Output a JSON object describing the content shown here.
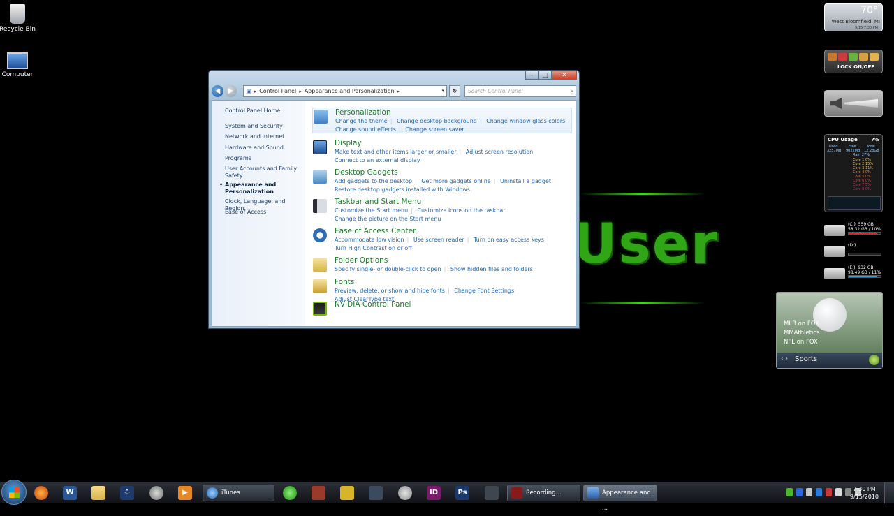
{
  "desktop": {
    "icons": [
      {
        "label": "Recycle Bin"
      },
      {
        "label": "Computer"
      }
    ],
    "wallpaper_text": "User"
  },
  "window": {
    "address": {
      "crumbs": [
        "Control Panel",
        "Appearance and Personalization"
      ]
    },
    "search_placeholder": "Search Control Panel",
    "sidebar": {
      "items": [
        {
          "label": "Control Panel Home"
        },
        {
          "label": "System and Security"
        },
        {
          "label": "Network and Internet"
        },
        {
          "label": "Hardware and Sound"
        },
        {
          "label": "Programs"
        },
        {
          "label": "User Accounts and Family Safety"
        },
        {
          "label": "Appearance and Personalization",
          "active": true
        },
        {
          "label": "Clock, Language, and Region"
        },
        {
          "label": "Ease of Access"
        }
      ]
    },
    "categories": [
      {
        "title": "Personalization",
        "icon": "personalization-icon",
        "color": "#3f7fc4",
        "links": [
          "Change the theme",
          "Change desktop background",
          "Change window glass colors",
          "Change sound effects",
          "Change screen saver"
        ]
      },
      {
        "title": "Display",
        "icon": "display-icon",
        "color": "#2a5ea8",
        "links": [
          "Make text and other items larger or smaller",
          "Adjust screen resolution",
          "Connect to an external display"
        ]
      },
      {
        "title": "Desktop Gadgets",
        "icon": "gadgets-icon",
        "color": "#4a8ac4",
        "links": [
          "Add gadgets to the desktop",
          "Get more gadgets online",
          "Uninstall a gadget",
          "Restore desktop gadgets installed with Windows"
        ]
      },
      {
        "title": "Taskbar and Start Menu",
        "icon": "taskbar-icon",
        "color": "#6a6f78",
        "links": [
          "Customize the Start menu",
          "Customize icons on the taskbar",
          "Change the picture on the Start menu"
        ]
      },
      {
        "title": "Ease of Access Center",
        "icon": "ease-of-access-icon",
        "color": "#2e6db6",
        "links": [
          "Accommodate low vision",
          "Use screen reader",
          "Turn on easy access keys",
          "Turn High Contrast on or off"
        ]
      },
      {
        "title": "Folder Options",
        "icon": "folder-icon",
        "color": "#e3c45a",
        "links": [
          "Specify single- or double-click to open",
          "Show hidden files and folders"
        ]
      },
      {
        "title": "Fonts",
        "icon": "fonts-icon",
        "color": "#d9b64a",
        "links": [
          "Preview, delete, or show and hide fonts",
          "Change Font Settings",
          "Adjust ClearType text"
        ]
      },
      {
        "title": "NVIDIA Control Panel",
        "icon": "nvidia-icon",
        "color": "#4a8a1e",
        "links": []
      }
    ]
  },
  "gadgets": {
    "weather": {
      "temp": "70°",
      "city": "West Bloomfield, MI",
      "time": "9/15 7:30 PM"
    },
    "lock": {
      "label": "LOCK ON/OFF"
    },
    "cpu": {
      "title": "CPU Usage",
      "total_pct": "7%",
      "cols": [
        "Used",
        "Free",
        "Total"
      ],
      "mem": [
        "3257MB",
        "9022MB",
        "12.28GB"
      ],
      "ram": "Ram  27%",
      "cores": [
        {
          "label": "Core 1",
          "pct": "0%"
        },
        {
          "label": "Core 2",
          "pct": "15%"
        },
        {
          "label": "Core 3",
          "pct": "11%"
        },
        {
          "label": "Core 4",
          "pct": "0%"
        },
        {
          "label": "Core 5",
          "pct": "0%"
        },
        {
          "label": "Core 6",
          "pct": "0%"
        },
        {
          "label": "Core 7",
          "pct": "5%"
        },
        {
          "label": "Core 8",
          "pct": "0%"
        }
      ]
    },
    "drives": [
      {
        "name": "(C:)",
        "size": "559 GB",
        "detail": "58.32 GB / 10%",
        "fill": 0.9,
        "color": "#d02a2a"
      },
      {
        "name": "(D:)",
        "size": "",
        "detail": "",
        "fill": 0,
        "color": "#888888"
      },
      {
        "name": "(E:)",
        "size": "932 GB",
        "detail": "98.49 GB / 11%",
        "fill": 0.89,
        "color": "#3aa0d8"
      }
    ],
    "sports": {
      "lines": [
        "MLB on FOX",
        "MMAthletics",
        "NFL on FOX"
      ],
      "footer": "Sports"
    }
  },
  "taskbar": {
    "tasks": [
      {
        "label": "iTunes"
      },
      {
        "label": "Recording..."
      },
      {
        "label": "Appearance and ..."
      }
    ],
    "clock": {
      "time": "7:30 PM",
      "date": "9/15/2010"
    }
  }
}
